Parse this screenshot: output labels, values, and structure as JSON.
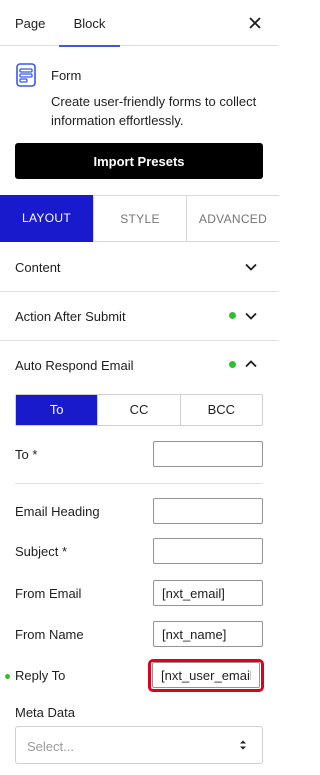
{
  "tabs": {
    "page": "Page",
    "block": "Block"
  },
  "block_info": {
    "title": "Form",
    "description": "Create user-friendly forms to collect information effortlessly."
  },
  "import_button": "Import Presets",
  "mode_tabs": [
    "LAYOUT",
    "STYLE",
    "ADVANCED"
  ],
  "panels": {
    "content": "Content",
    "action_after_submit": "Action After Submit",
    "auto_respond_email": "Auto Respond Email"
  },
  "recipient_tabs": [
    "To",
    "CC",
    "BCC"
  ],
  "fields": {
    "to": {
      "label": "To *",
      "value": ""
    },
    "email_heading": {
      "label": "Email Heading",
      "value": ""
    },
    "subject": {
      "label": "Subject *",
      "value": ""
    },
    "from_email": {
      "label": "From Email",
      "value": "[nxt_email]"
    },
    "from_name": {
      "label": "From Name",
      "value": "[nxt_name]"
    },
    "reply_to": {
      "label": "Reply To",
      "value": "[nxt_user_email]"
    }
  },
  "meta_data": {
    "label": "Meta Data",
    "selected": "Select..."
  },
  "colors": {
    "accent": "#1a1acd",
    "status_dot": "#2ec12e",
    "highlight": "#e0001b",
    "tab_underline": "#3858e9"
  }
}
